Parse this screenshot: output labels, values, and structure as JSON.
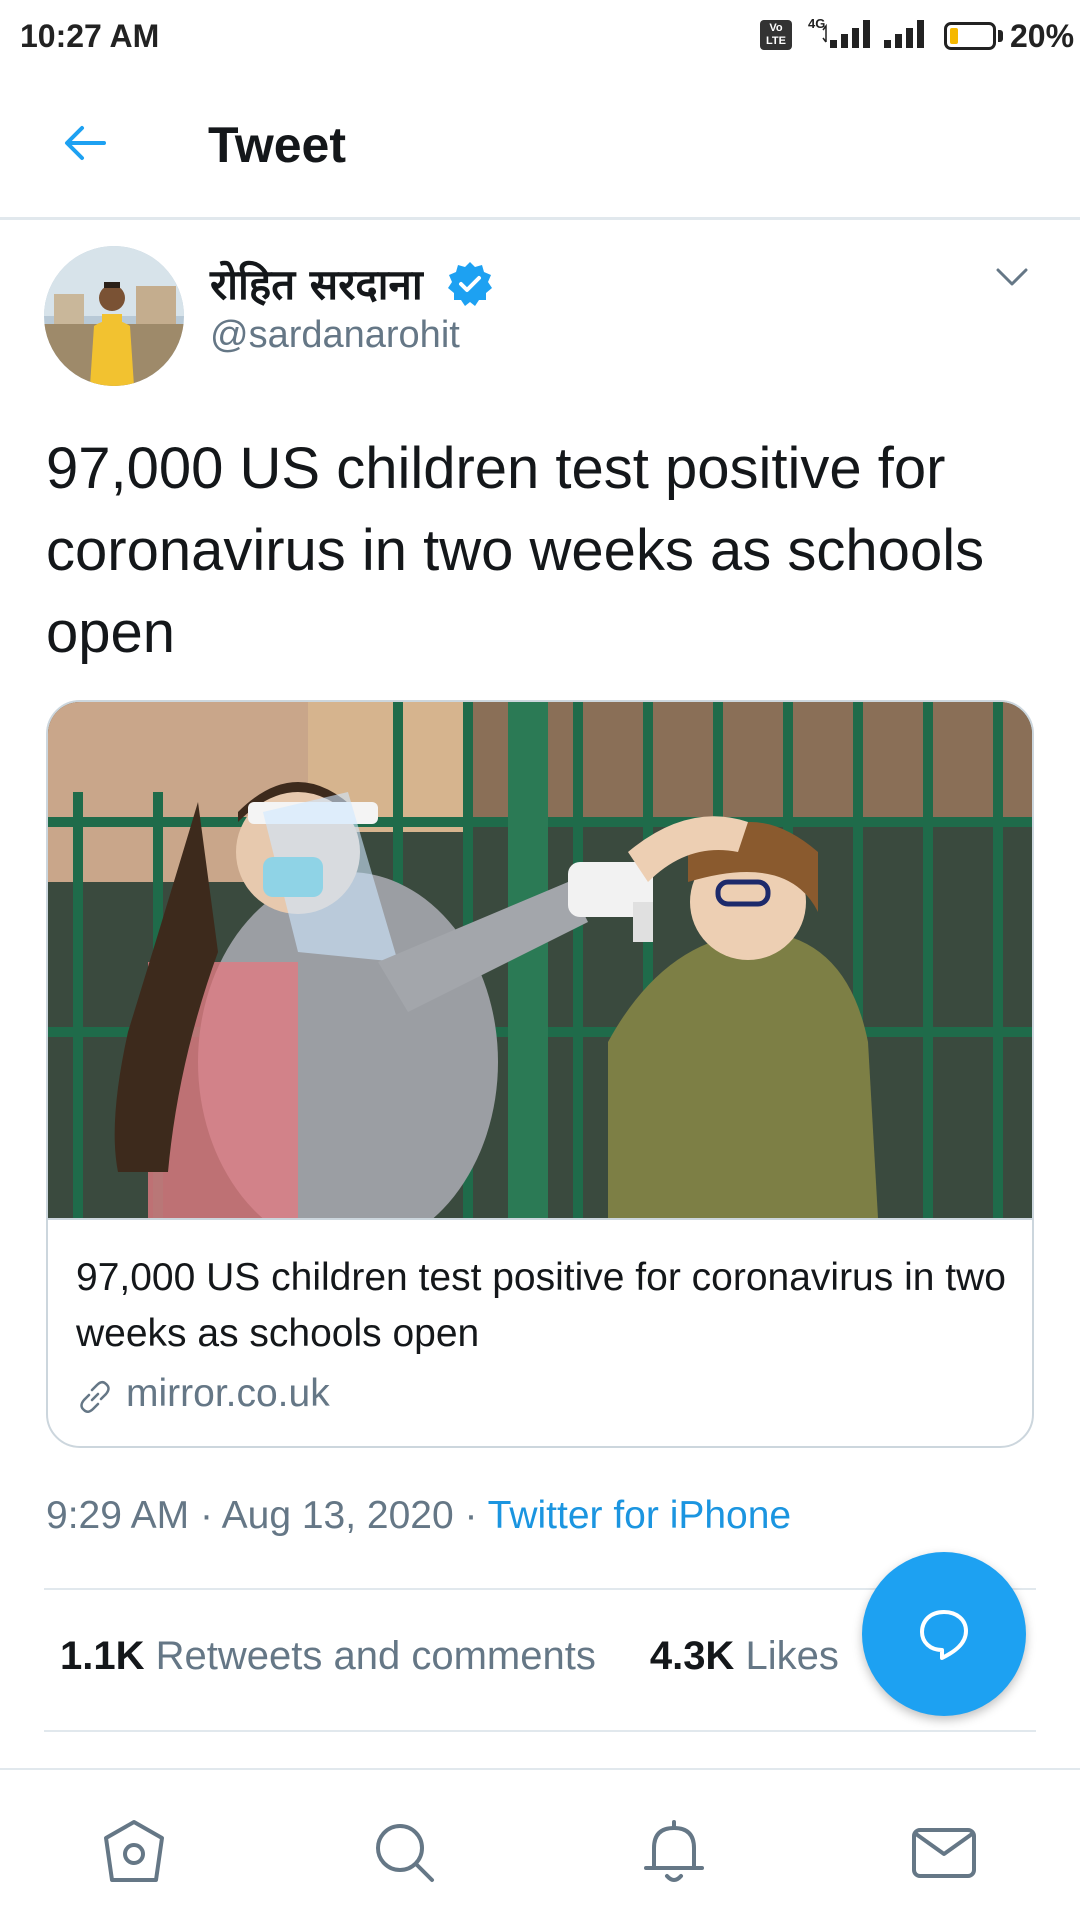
{
  "status_bar": {
    "time": "10:27 AM",
    "volte_label": "Vo LTE",
    "network_label": "4G",
    "battery_percent_text": "20%",
    "battery_level": 0.2
  },
  "header": {
    "title": "Tweet"
  },
  "tweet": {
    "author_name": "रोहित सरदाना",
    "author_handle": "@sardanarohit",
    "text": "97,000 US children test positive for coronavirus in two weeks as schools open",
    "card": {
      "title": "97,000 US children test positive for coronavirus in two weeks as schools open",
      "domain": "mirror.co.uk"
    },
    "time": "9:29 AM",
    "date": "Aug 13, 2020",
    "separator": "·",
    "source": "Twitter for iPhone",
    "stats": {
      "retweets_count": "1.1K",
      "retweets_label": "Retweets and comments",
      "likes_count": "4.3K",
      "likes_label": "Likes"
    }
  },
  "colors": {
    "accent": "#1da1f2",
    "link": "#1b95e0",
    "secondary_text": "#657786",
    "border": "#e1e8ed"
  },
  "icons": {
    "back": "arrow-left-icon",
    "verified": "verified-badge-icon",
    "caret": "chevron-down-icon",
    "link": "link-icon",
    "compose": "speech-bubble-icon",
    "nav": [
      "home-icon",
      "search-icon",
      "bell-icon",
      "mail-icon"
    ]
  }
}
